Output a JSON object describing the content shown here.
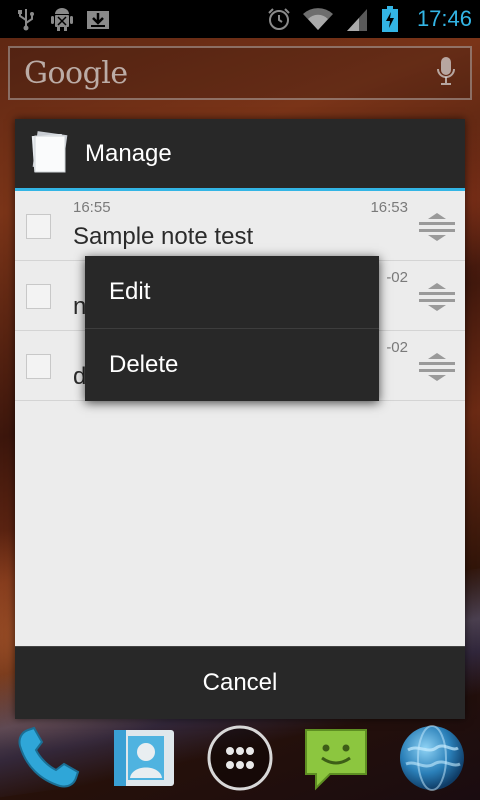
{
  "status_bar": {
    "time": "17:46",
    "left_icons": [
      "usb-icon",
      "android-debug-icon",
      "download-icon"
    ],
    "right_icons": [
      "alarm-icon",
      "wifi-icon",
      "signal-icon",
      "battery-charging-icon"
    ]
  },
  "search": {
    "logo_text": "Google",
    "mic_icon": "microphone-icon"
  },
  "dialog": {
    "title": "Manage",
    "title_icon": "notes-icon",
    "accent_color": "#33b5e5",
    "items": [
      {
        "time_left": "16:55",
        "time_right": "16:53",
        "title": "Sample note test",
        "checked": false
      },
      {
        "time_left": "",
        "time_right": "-02",
        "title": "n",
        "checked": false
      },
      {
        "time_left": "",
        "time_right": "-02",
        "title": "d",
        "checked": false
      }
    ],
    "cancel_label": "Cancel"
  },
  "context_menu": {
    "items": [
      "Edit",
      "Delete"
    ]
  },
  "dock": {
    "icons": [
      "phone-icon",
      "contacts-icon",
      "app-drawer-icon",
      "messaging-icon",
      "browser-icon"
    ]
  }
}
